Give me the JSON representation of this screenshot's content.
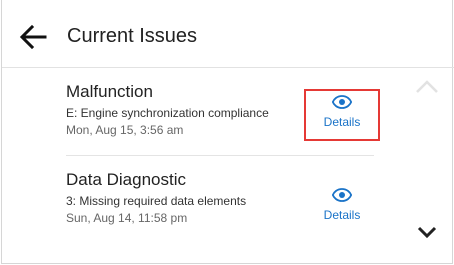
{
  "header": {
    "title": "Current Issues"
  },
  "issues": [
    {
      "name": "Malfunction",
      "code": "E: Engine synchronization compliance",
      "time": "Mon, Aug 15, 3:56 am",
      "details_label": "Details",
      "highlighted": true
    },
    {
      "name": "Data Diagnostic",
      "code": "3: Missing required data elements",
      "time": "Sun, Aug 14, 11:58 pm",
      "details_label": "Details",
      "highlighted": false
    }
  ],
  "colors": {
    "link": "#1a73c8",
    "highlight": "#e53935",
    "chevron_disabled": "#e2e2e2",
    "chevron_enabled": "#222222"
  },
  "icons": {
    "back": "arrow-left-icon",
    "details": "eye-icon",
    "scroll_up": "chevron-up-icon",
    "scroll_down": "chevron-down-icon"
  }
}
